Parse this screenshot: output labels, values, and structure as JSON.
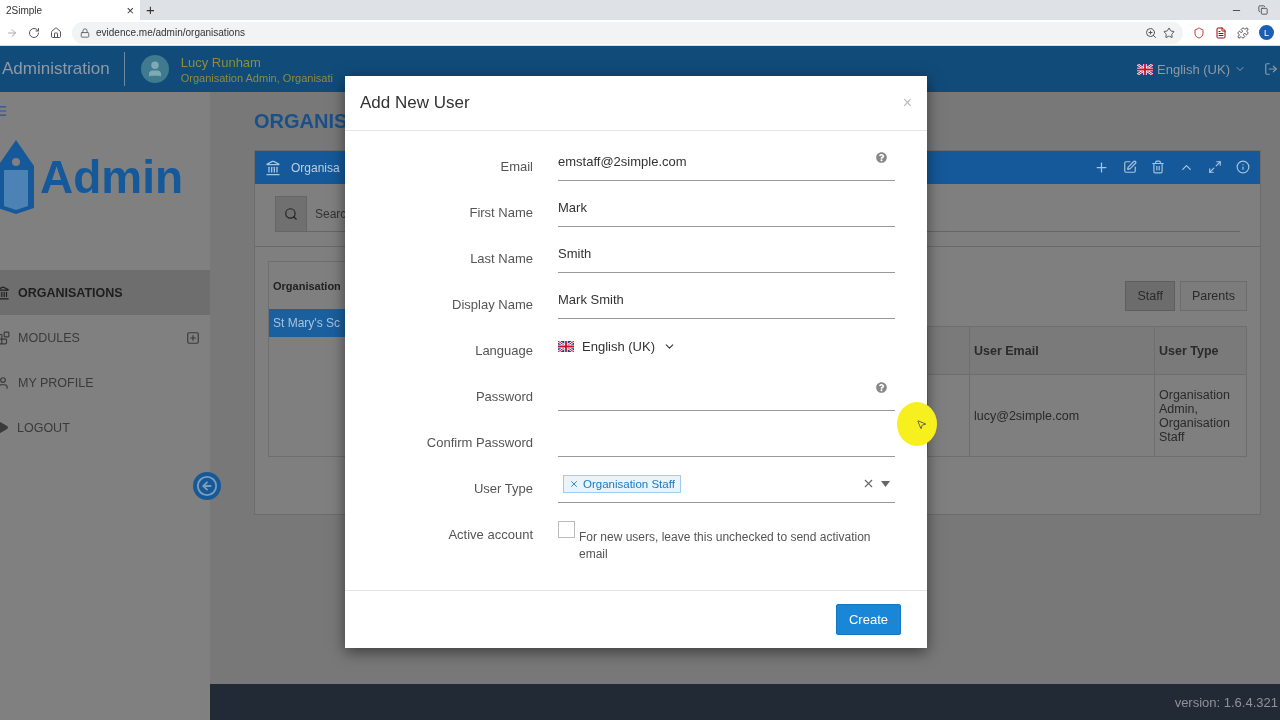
{
  "browser": {
    "tab": {
      "title": "2Simple",
      "close": "×"
    },
    "new_tab": "+",
    "url": "evidence.me/admin/organisations",
    "profile_initial": "L"
  },
  "header": {
    "app_title": "Administration",
    "user_name": "Lucy Runham",
    "user_role": "Organisation Admin, Organisati",
    "language": "English (UK)"
  },
  "sidebar": {
    "logo_text": "Admin",
    "items": [
      {
        "label": "ORGANISATIONS",
        "kind": "bank",
        "selected": true
      },
      {
        "label": "MODULES",
        "kind": "modules",
        "selected": false
      },
      {
        "label": "MY PROFILE",
        "kind": "profile",
        "selected": false
      },
      {
        "label": "LOGOUT",
        "kind": "logout",
        "selected": false
      }
    ]
  },
  "page": {
    "title": "ORGANIS",
    "panel_title": "Organisa",
    "search_placeholder": "Searc",
    "org_table": {
      "header": "Organisation",
      "rows": [
        {
          "name": "St Mary's Sc",
          "selected": true
        }
      ]
    },
    "filters": [
      {
        "label": "Staff",
        "selected": true
      },
      {
        "label": "Parents",
        "selected": false
      }
    ],
    "users_table": {
      "columns": [
        "User Email",
        "User Type"
      ],
      "rows": [
        [
          "lucy@2simple.com",
          "Organisation Admin, Organisation Staff"
        ]
      ]
    }
  },
  "modal": {
    "title": "Add New User",
    "close": "×",
    "fields": [
      {
        "label": "Email",
        "kind": "text",
        "value": "emstaff@2simple.com",
        "help": true
      },
      {
        "label": "First Name",
        "kind": "text",
        "value": "Mark",
        "help": false
      },
      {
        "label": "Last Name",
        "kind": "text",
        "value": "Smith",
        "help": false
      },
      {
        "label": "Display Name",
        "kind": "text",
        "value": "Mark Smith",
        "help": false
      },
      {
        "label": "Language",
        "kind": "language",
        "value": "English (UK)"
      },
      {
        "label": "Password",
        "kind": "password",
        "help": true
      },
      {
        "label": "Confirm Password",
        "kind": "password",
        "help": false
      },
      {
        "label": "User Type",
        "kind": "tags",
        "tags": [
          "Organisation Staff"
        ]
      },
      {
        "label": "Active account",
        "kind": "checkbox",
        "checked": false,
        "hint": "For new users, leave this unchecked to send activation email"
      }
    ],
    "button": "Create"
  },
  "footer": {
    "version": "version: 1.6.4.321"
  }
}
